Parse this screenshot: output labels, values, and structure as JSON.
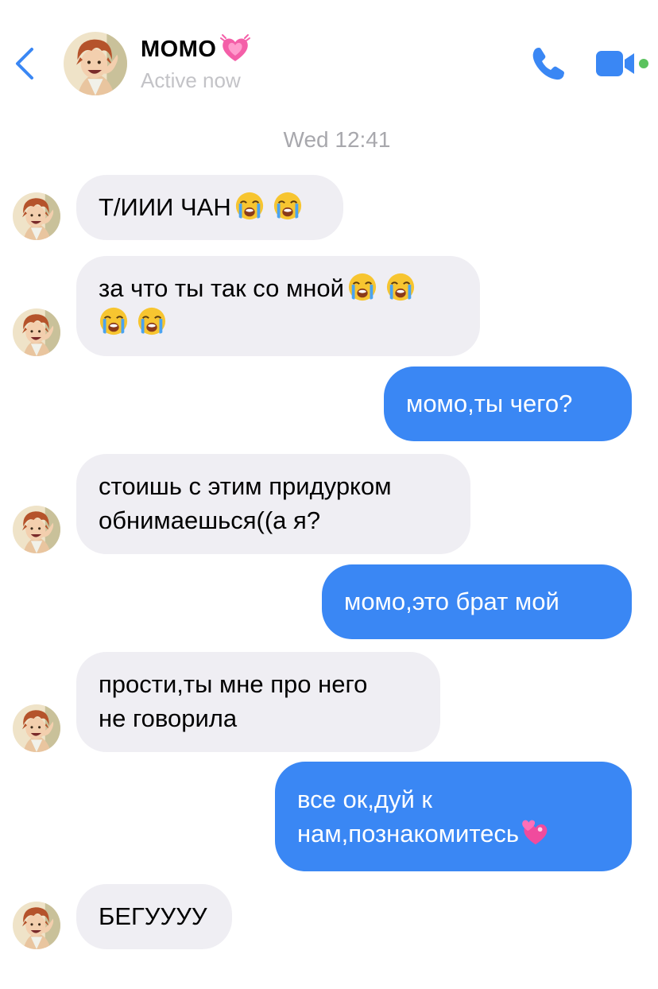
{
  "header": {
    "contact_name": "МОМО",
    "status": "Active now",
    "accent_color": "#3a87f4",
    "icons": {
      "back": "chevron-left-icon",
      "name_emoji": "growing-heart-icon",
      "call": "phone-icon",
      "video": "video-camera-icon",
      "online": "online-dot-icon"
    }
  },
  "timestamp": "Wed 12:41",
  "messages": [
    {
      "direction": "in",
      "text": "Т/ИИИ ЧАН",
      "emoji": [
        "crying-face",
        "crying-face"
      ]
    },
    {
      "direction": "in",
      "text": "за что ты так со мной",
      "emoji": [
        "crying-face",
        "crying-face",
        "crying-face",
        "crying-face"
      ]
    },
    {
      "direction": "out",
      "text": "момо,ты чего?"
    },
    {
      "direction": "in",
      "text": "стоишь с этим придурком\nобнимаешься((а я?"
    },
    {
      "direction": "out",
      "text": "момо,это брат мой"
    },
    {
      "direction": "in",
      "text": "прости,ты мне про него\nне говорила"
    },
    {
      "direction": "out",
      "text": "все ок,дуй к\nнам,познакомитесь",
      "emoji": [
        "two-hearts"
      ]
    },
    {
      "direction": "in",
      "text": "БЕГУУУУ"
    }
  ]
}
